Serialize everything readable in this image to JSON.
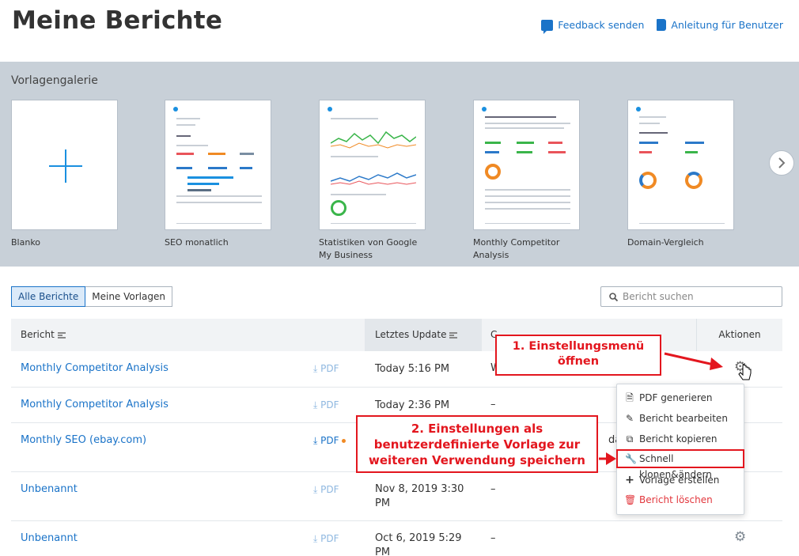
{
  "header": {
    "title": "Meine Berichte",
    "feedback_label": "Feedback senden",
    "guide_label": "Anleitung für Benutzer"
  },
  "gallery": {
    "title": "Vorlagengalerie",
    "templates": [
      {
        "label": "Blanko"
      },
      {
        "label": "SEO monatlich"
      },
      {
        "label": "Statistiken von Google My Business"
      },
      {
        "label": "Monthly Competitor Analysis"
      },
      {
        "label": "Domain-Vergleich"
      }
    ],
    "next_icon": "chevron-right-icon"
  },
  "tabs": [
    {
      "label": "Alle Berichte",
      "active": true
    },
    {
      "label": "Meine Vorlagen",
      "active": false
    }
  ],
  "search": {
    "placeholder": "Bericht suchen",
    "icon": "search-icon"
  },
  "table": {
    "columns": {
      "report": "Bericht",
      "updated": "Letztes Update",
      "actions": "Aktionen",
      "partial": "C"
    },
    "rows": [
      {
        "name": "Monthly Competitor Analysis",
        "pdf": "PDF",
        "updated": "Today 5:16 PM",
        "col": "W"
      },
      {
        "name": "Monthly Competitor Analysis",
        "pdf": "PDF",
        "updated": "Today 2:36 PM",
        "col": "–"
      },
      {
        "name": "Monthly SEO (ebay.com)",
        "pdf": "PDF",
        "updated": "",
        "col": "day"
      },
      {
        "name": "Unbenannt",
        "pdf": "PDF",
        "updated": "Nov 8, 2019 3:30 PM",
        "col": "–"
      },
      {
        "name": "Unbenannt",
        "pdf": "PDF",
        "updated": "Oct 6, 2019 5:29 PM",
        "col": "–"
      }
    ]
  },
  "dropdown": {
    "items": [
      {
        "label": "PDF generieren",
        "icon": "pdf-icon"
      },
      {
        "label": "Bericht bearbeiten",
        "icon": "pencil-icon"
      },
      {
        "label": "Bericht kopieren",
        "icon": "copy-icon"
      },
      {
        "label": "Schnell klonen&ändern",
        "icon": "wrench-icon"
      },
      {
        "label": "Vorlage erstellen",
        "icon": "plus-icon"
      },
      {
        "label": "Bericht löschen",
        "icon": "trash-icon"
      }
    ]
  },
  "annotations": {
    "step1_line1": "1. Einstellungsmenü",
    "step1_line2": "öffnen",
    "step2_line1": "2. Einstellungen als",
    "step2_line2": "benutzerdefinierte Vorlage zur",
    "step2_line3": "weiteren Verwendung speichern"
  },
  "colors": {
    "accent": "#1a73c8",
    "annotation": "#e3161e",
    "gallery_bg": "#c8d0d8",
    "danger": "#e2363c"
  }
}
